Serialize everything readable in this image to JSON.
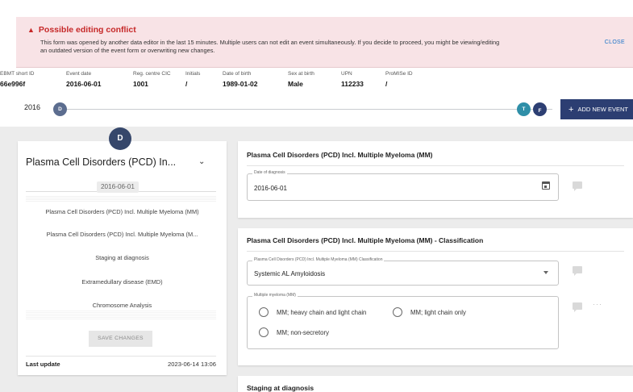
{
  "banner": {
    "warning_icon": "▲",
    "title": "Possible editing conflict",
    "text_line1": "This form was opened by another data editor in the last 15 minutes. Multiple users can not edit an event simultaneously. If you decide to proceed, you might be viewing/editing",
    "text_line2": "an outdated version of the event form or overwriting new changes.",
    "close_label": "CLOSE"
  },
  "patient_info": [
    {
      "label": "EBMT short ID",
      "value": "66e996f"
    },
    {
      "label": "Event date",
      "value": "2016-06-01"
    },
    {
      "label": "Reg. centre CIC",
      "value": "1001"
    },
    {
      "label": "Initials",
      "value": "/"
    },
    {
      "label": "Date of birth",
      "value": "1989-01-02"
    },
    {
      "label": "Sex at birth",
      "value": "Male"
    },
    {
      "label": "UPN",
      "value": "112233"
    },
    {
      "label": "ProMISe ID",
      "value": "/"
    }
  ],
  "timeline": {
    "year": "2016",
    "event_d": "D",
    "event_t": "T",
    "event_f": "F",
    "add_event_icon": "+",
    "add_event_label": "ADD NEW EVENT"
  },
  "left_panel": {
    "marker": "D",
    "title": "Plasma Cell Disorders (PCD) In...",
    "chevron": "⌄",
    "date": "2016-06-01",
    "items": [
      "Plasma Cell Disorders (PCD) Incl. Multiple Myeloma (MM)",
      "Plasma Cell Disorders (PCD) Incl. Multiple Myeloma (M...",
      "Staging at diagnosis",
      "Extramedullary disease (EMD)",
      "Chromosome Analysis"
    ],
    "save_label": "SAVE CHANGES",
    "last_update_label": "Last update",
    "last_update_value": "2023-06-14 13:06"
  },
  "section1": {
    "title": "Plasma Cell Disorders (PCD) Incl. Multiple Myeloma (MM)",
    "date_label": "Date of diagnosis",
    "date_value": "2016-06-01"
  },
  "section2": {
    "title": "Plasma Cell Disorders (PCD) Incl. Multiple Myeloma (MM) - Classification",
    "classification_label": "Plasma Cell Disorders (PCD) Incl. Multiple Myeloma (MM) Classification",
    "classification_value": "Systemic AL Amyloidosis",
    "mm_label": "Multiple myeloma (MM)",
    "mm_options": [
      "MM; heavy chain and light chain",
      "MM; light chain only",
      "MM; non-secretory"
    ],
    "more_icon": "···"
  },
  "section3": {
    "title": "Staging at diagnosis"
  }
}
